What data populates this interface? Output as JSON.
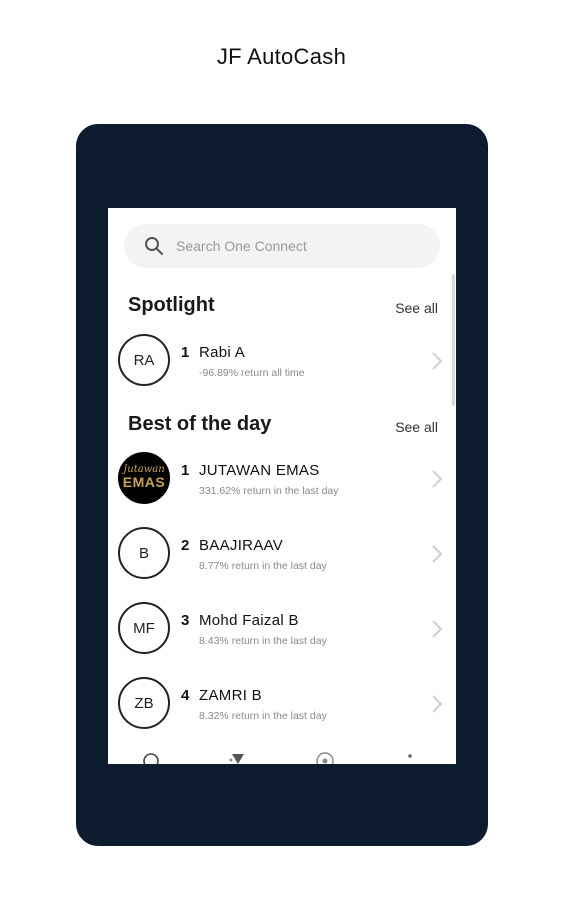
{
  "app": {
    "title": "JF AutoCash"
  },
  "search": {
    "placeholder": "Search One Connect"
  },
  "spotlight": {
    "title": "Spotlight",
    "see_all": "See all",
    "items": [
      {
        "initials": "RA",
        "rank": "1",
        "name": "Rabi A",
        "subtitle": "-96.89% return all time"
      }
    ]
  },
  "best_of_day": {
    "title": "Best of the day",
    "see_all": "See all",
    "items": [
      {
        "initials": "",
        "logo_script": "Jutawan",
        "logo_main": "EMAS",
        "rank": "1",
        "name": "JUTAWAN EMAS",
        "subtitle": "331.62% return in the last day"
      },
      {
        "initials": "B",
        "rank": "2",
        "name": "BAAJIRAAV",
        "subtitle": "8.77% return in the last day"
      },
      {
        "initials": "MF",
        "rank": "3",
        "name": "Mohd Faizal B",
        "subtitle": "8.43% return in the last day"
      },
      {
        "initials": "ZB",
        "rank": "4",
        "name": "ZAMRI B",
        "subtitle": "8.32% return in the last day"
      }
    ]
  },
  "colors": {
    "device": "#0d1b2e",
    "logo_gold": "#c8a24a"
  },
  "icons": [
    "search-icon",
    "chevron-right-icon",
    "home-icon",
    "leaderboard-icon",
    "compass-icon",
    "more-icon"
  ]
}
